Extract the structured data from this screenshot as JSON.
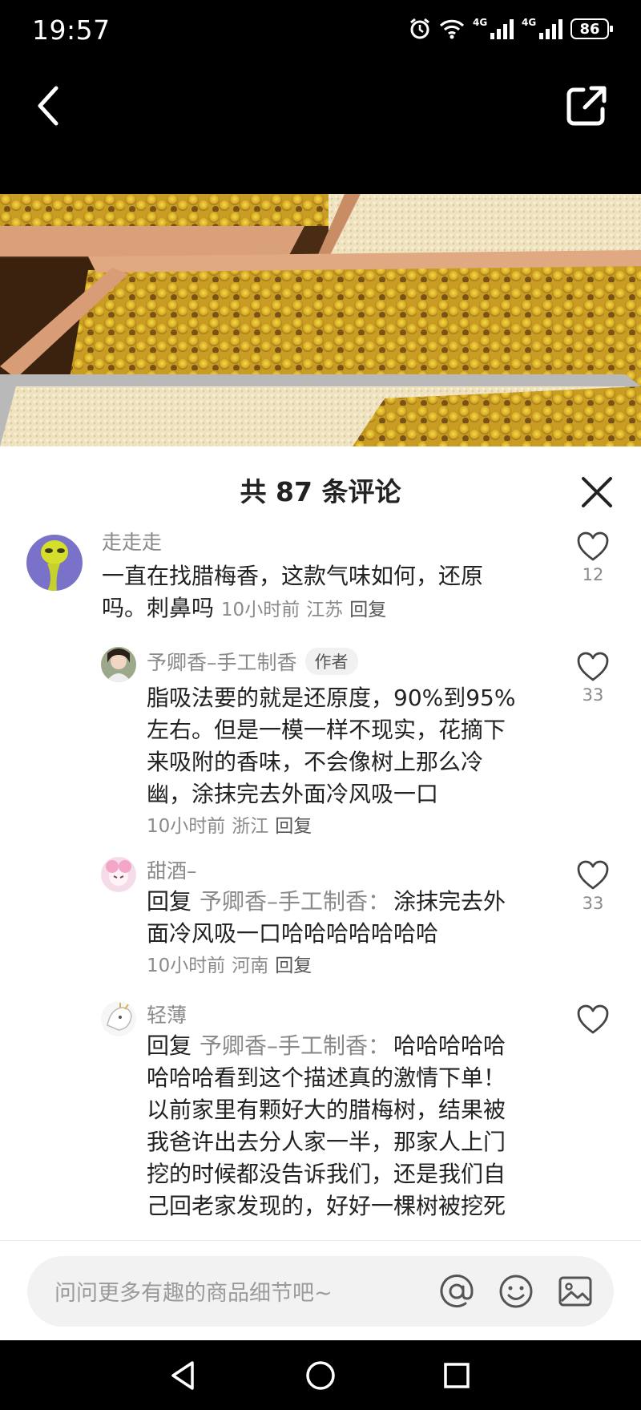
{
  "status_bar": {
    "time": "19:57",
    "net_a": "4G",
    "net_b": "4G",
    "battery": "86"
  },
  "sheet": {
    "title": "共 87 条评论"
  },
  "comments": [
    {
      "user": "走走走",
      "text_lines": [
        "一直在找腊梅香，这款气味如何，还原",
        "吗。刺鼻吗"
      ],
      "time": "10小时前",
      "location": "江苏",
      "reply": "回复",
      "likes": "12"
    },
    {
      "user": "予卿香–手工制香",
      "badge": "作者",
      "text_lines": [
        "脂吸法要的就是还原度，90%到95%",
        "左右。但是一模一样不现实，花摘下",
        "来吸附的香味，不会像树上那么冷",
        "幽，涂抹完去外面冷风吸一口"
      ],
      "time": "10小时前",
      "location": "浙江",
      "reply": "回复",
      "likes": "33"
    },
    {
      "user": "甜酒–",
      "reply_prefix": "回复",
      "reply_to": "予卿香–手工制香：",
      "text_lines": [
        "涂抹完去外",
        "面冷风吸一口哈哈哈哈哈哈哈"
      ],
      "time": "10小时前",
      "location": "河南",
      "reply": "回复",
      "likes": "33"
    },
    {
      "user": "轻薄",
      "reply_prefix": "回复",
      "reply_to": "予卿香–手工制香：",
      "text_lines": [
        "哈哈哈哈哈",
        "哈哈哈看到这个描述真的激情下单！",
        "以前家里有颗好大的腊梅树，结果被",
        "我爸许出去分人家一半，那家人上门",
        "挖的时候都没告诉我们，还是我们自",
        "己回老家发现的，好好一棵树被挖死"
      ]
    }
  ],
  "input": {
    "placeholder": "问问更多有趣的商品细节吧~"
  },
  "icons": [
    "back-icon",
    "share-icon",
    "close-icon",
    "heart-icon",
    "at-icon",
    "emoji-icon",
    "image-icon",
    "nav-back-icon",
    "nav-home-icon",
    "nav-recents-icon"
  ]
}
